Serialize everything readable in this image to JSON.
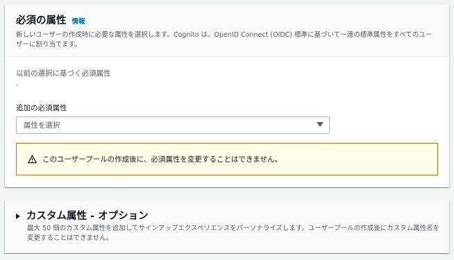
{
  "required_attributes": {
    "title": "必須の属性",
    "info_link": "情報",
    "description": "新しいユーザーの作成時に必要な属性を選択します。Cognito は、OpenID Connect (OIDC) 標準に基づいて一連の標準属性をすべてのユーザーに割り当てます。",
    "previous_label": "以前の選択に基づく必須属性",
    "previous_value": "-",
    "additional_label": "追加の必須属性",
    "select_placeholder": "属性を選択",
    "warning_text": "このユーザープールの作成後に、必須属性を変更することはできません。"
  },
  "custom_attributes": {
    "title": "カスタム属性 - オプション",
    "description": "最大 50 個のカスタム属性を追加してサインアップエクスペリエンスをパーソナライズします。ユーザープールの作成後にカスタム属性名を変更することはできません。"
  },
  "icons": {
    "warning": "warning-icon",
    "select_caret": "caret-down-icon",
    "expand_caret": "caret-right-icon"
  },
  "colors": {
    "info_link": "#0073bb",
    "warning_border": "#ab7a1b",
    "warning_background": "#fffce9"
  }
}
